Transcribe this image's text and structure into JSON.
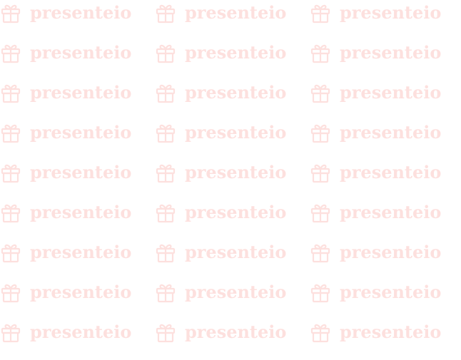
{
  "watermark": {
    "text": "presenteio",
    "icon": "gift-icon",
    "color": "#fde0de",
    "rows": 9,
    "columns": 3
  }
}
